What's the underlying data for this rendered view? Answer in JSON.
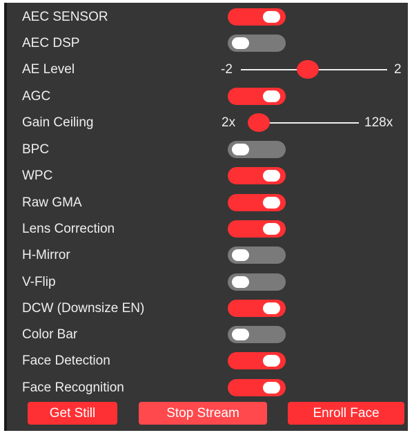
{
  "settings": [
    {
      "label": "AEC SENSOR",
      "type": "toggle",
      "on": true
    },
    {
      "label": "AEC DSP",
      "type": "toggle",
      "on": false
    },
    {
      "label": "AE Level",
      "type": "slider",
      "min": "-2",
      "max": "2",
      "value": 0.45
    },
    {
      "label": "AGC",
      "type": "toggle",
      "on": true
    },
    {
      "label": "Gain Ceiling",
      "type": "slider",
      "min": "2x",
      "max": "128x",
      "value": 0.0
    },
    {
      "label": "BPC",
      "type": "toggle",
      "on": false
    },
    {
      "label": "WPC",
      "type": "toggle",
      "on": true
    },
    {
      "label": "Raw GMA",
      "type": "toggle",
      "on": true
    },
    {
      "label": "Lens Correction",
      "type": "toggle",
      "on": true
    },
    {
      "label": "H-Mirror",
      "type": "toggle",
      "on": false
    },
    {
      "label": "V-Flip",
      "type": "toggle",
      "on": false
    },
    {
      "label": "DCW (Downsize EN)",
      "type": "toggle",
      "on": true
    },
    {
      "label": "Color Bar",
      "type": "toggle",
      "on": false
    },
    {
      "label": "Face Detection",
      "type": "toggle",
      "on": true
    },
    {
      "label": "Face Recognition",
      "type": "toggle",
      "on": true
    }
  ],
  "buttons": {
    "get_still": "Get Still",
    "stop_stream": "Stop Stream",
    "enroll_face": "Enroll Face"
  },
  "colors": {
    "accent": "#ff3034",
    "toggle_off": "#7a7a7a",
    "panel_bg": "#363636",
    "text": "#efefef"
  }
}
